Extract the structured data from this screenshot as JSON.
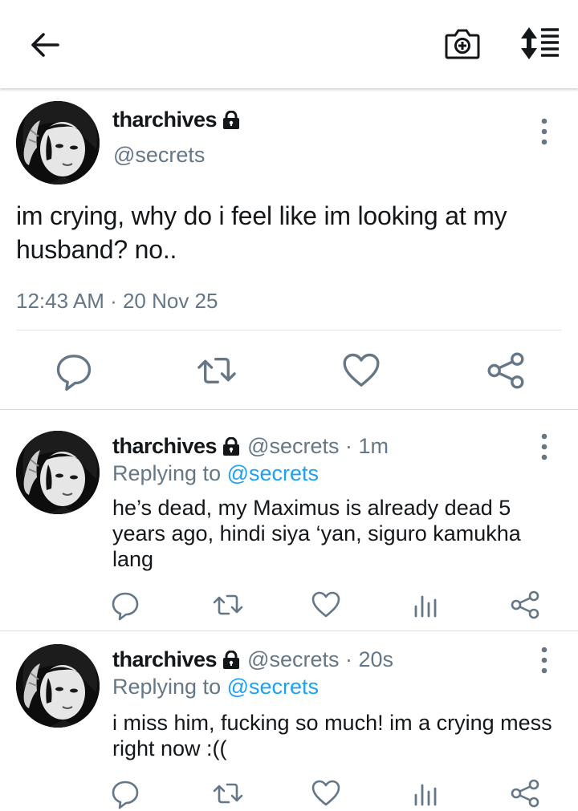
{
  "header": {
    "back_icon": "arrow-left-icon",
    "camera_icon": "camera-add-icon",
    "sort_icon": "sort-list-icon"
  },
  "main_tweet": {
    "display_name": "tharchives",
    "handle": "@secrets",
    "text": "im crying, why do i feel like im looking at my husband? no..",
    "timestamp": "12:43 AM · 20 Nov 25",
    "protected_icon": "lock-icon"
  },
  "replies": [
    {
      "display_name": "tharchives",
      "meta": "@secrets · 1m",
      "replying_prefix": "Replying to",
      "replying_to": "@secrets",
      "text": "he’s dead, my Maximus is already dead 5 years ago, hindi siya ‘yan, siguro kamukha lang"
    },
    {
      "display_name": "tharchives",
      "meta": "@secrets · 20s",
      "replying_prefix": "Replying to",
      "replying_to": "@secrets",
      "text": "i miss him, fucking so much! im a crying mess right now :(("
    }
  ],
  "colors": {
    "text": "#14171a",
    "secondary": "#657786",
    "link": "#1da1f2",
    "icon": "#657786",
    "divider": "#e1e8ed"
  }
}
